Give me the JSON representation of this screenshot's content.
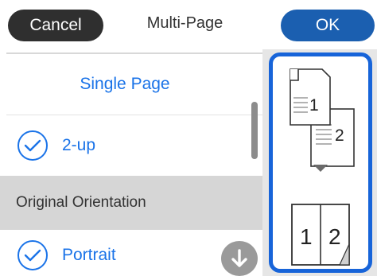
{
  "header": {
    "cancel_label": "Cancel",
    "title": "Multi-Page",
    "ok_label": "OK"
  },
  "list": {
    "single_page": "Single Page",
    "two_up": "2-up",
    "section_header": "Original Orientation",
    "portrait": "Portrait"
  },
  "preview": {
    "before_page_1": "1",
    "before_page_2": "2",
    "after_page_1": "1",
    "after_page_2": "2"
  },
  "colors": {
    "accent": "#1a73e8",
    "ok_button": "#1b5fb0",
    "cancel_button": "#2f2f2f",
    "preview_border": "#1764d9"
  },
  "icons": [
    "checkmark-icon",
    "scroll-down-icon",
    "arrow-down-icon"
  ]
}
